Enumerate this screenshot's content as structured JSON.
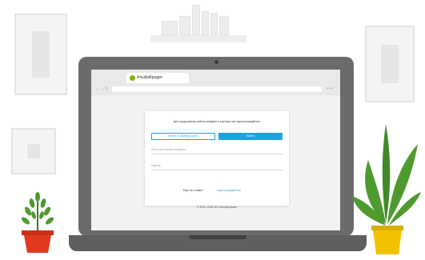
{
  "browser": {
    "tab_title": "АльфаКредит"
  },
  "login": {
    "heading": "Для продолжения работы войдите в систему или зарегистрируйтесь",
    "outline_button_label": "Войти по номеру карты",
    "primary_button_label": "Войти",
    "login_placeholder": "Логин или номер телефона",
    "password_placeholder": "Пароль",
    "bottom_text": "Еще не с нами?",
    "register_link": "Зарегистрируйтесь",
    "footer": "© 2001–2018 АО «Альфа-Банк»"
  },
  "colors": {
    "accent": "#1fa3e0",
    "logo_green": "#7ab800",
    "laptop": "#6b6b6b",
    "pot_red": "#e03a1e",
    "pot_yellow": "#f2c200",
    "plant_green": "#4e9a2e"
  }
}
